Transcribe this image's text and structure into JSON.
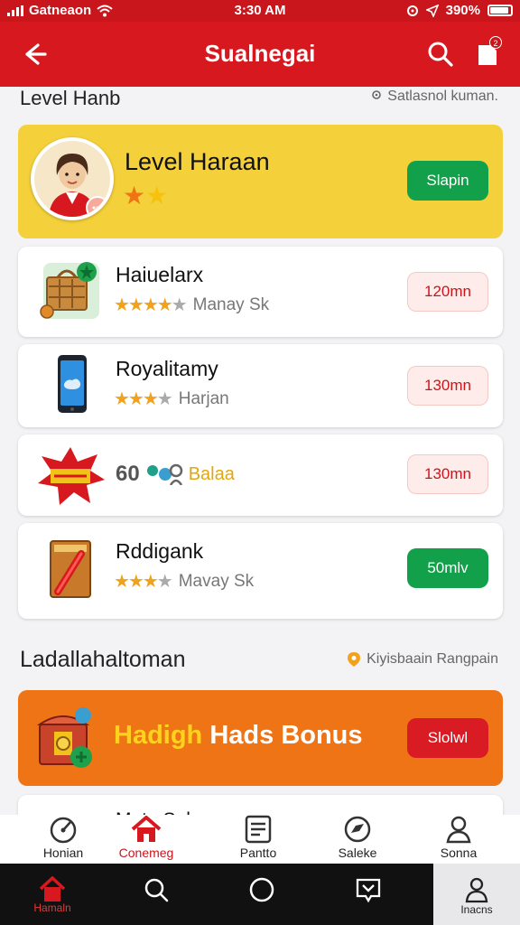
{
  "status": {
    "carrier": "Gatneaon",
    "time": "3:30 AM",
    "battery": "390%"
  },
  "appbar": {
    "title": "Sualnegai"
  },
  "section1": {
    "heading": "Level Hanb",
    "meta": "Satlasnol kuman."
  },
  "featured": {
    "title": "Level Haraan",
    "button": "Slapin",
    "stars": 2
  },
  "items": [
    {
      "title": "Haiuelarx",
      "subtitle": "Manay Sk",
      "button": "120mn",
      "stars": 4
    },
    {
      "title": "Royalitamy",
      "subtitle": "Harjan",
      "button": "130mn",
      "stars": 4
    },
    {
      "title": "Balaa",
      "prefix": "60",
      "subtitle": "",
      "button": "130mn",
      "stars": 0
    },
    {
      "title": "Rddigank",
      "subtitle": "Mavay Sk",
      "button": "50mlv",
      "stars": 4
    }
  ],
  "section2": {
    "heading": "Ladallahaltoman",
    "meta": "Kiyisbaain Rangpain"
  },
  "banner": {
    "text_highlight": "Hadigh",
    "text_main": "Hads Bonus",
    "button": "Slolwl"
  },
  "peek": {
    "title": "Mata Sak"
  },
  "tabs": [
    {
      "label": "Honian",
      "icon": "gauge-icon"
    },
    {
      "label": "Conemeg",
      "icon": "house-icon"
    },
    {
      "label": "Pantto",
      "icon": "document-icon"
    },
    {
      "label": "Saleke",
      "icon": "compass-icon"
    },
    {
      "label": "Sonna",
      "icon": "person-icon"
    }
  ],
  "sysnav": [
    {
      "label": "Hamaln",
      "icon": "home-icon"
    },
    {
      "label": "",
      "icon": "search-icon"
    },
    {
      "label": "",
      "icon": "circle-icon"
    },
    {
      "label": "",
      "icon": "message-icon"
    },
    {
      "label": "Inacns",
      "icon": "person-icon"
    }
  ],
  "colors": {
    "primary": "#d7191f",
    "yellow": "#f4d03a",
    "orange": "#ef7416",
    "green": "#12a14a"
  }
}
